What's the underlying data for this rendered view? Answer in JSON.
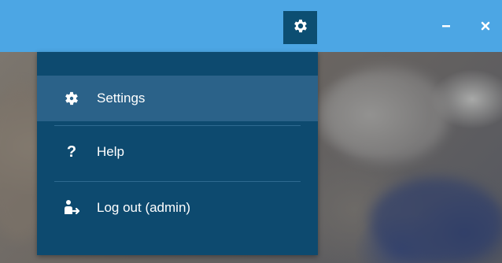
{
  "titlebar": {
    "settings_icon": "gear-icon",
    "minimize_symbol": "–",
    "close_symbol": "×"
  },
  "menu": {
    "items": [
      {
        "label": "Settings",
        "icon": "gear-icon",
        "active": true
      },
      {
        "label": "Help",
        "icon": "question-icon",
        "glyph": "?"
      },
      {
        "label": "Log out (admin)",
        "icon": "logout-user-icon"
      }
    ]
  },
  "colors": {
    "titlebar": "#4ca6e4",
    "menu_bg": "#0d4a6f",
    "menu_active": "#2b6289",
    "gear_button": "#0c4e72"
  }
}
